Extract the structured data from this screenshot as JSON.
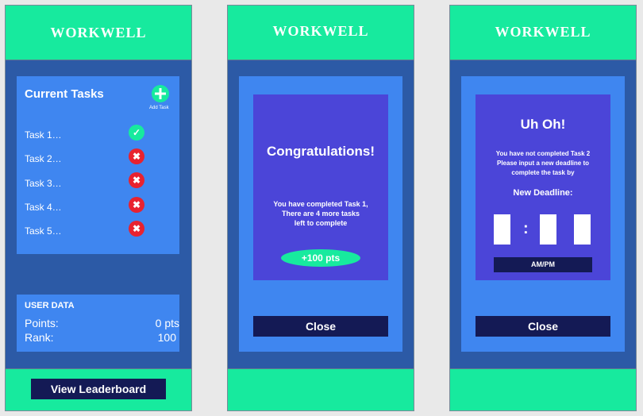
{
  "screens": [
    {
      "brand": "WORKWELL",
      "tasks_title": "Current Tasks",
      "add_task_label": "Add Task",
      "tasks": [
        {
          "label": "Task 1…",
          "status": "complete"
        },
        {
          "label": "Task 2…",
          "status": "incomplete"
        },
        {
          "label": "Task 3…",
          "status": "incomplete"
        },
        {
          "label": "Task 4…",
          "status": "incomplete"
        },
        {
          "label": "Task 5…",
          "status": "incomplete"
        }
      ],
      "user_data_title": "USER DATA",
      "points_label": "Points:",
      "points_value": "0 pts",
      "rank_label": "Rank:",
      "rank_value": "100",
      "leaderboard_button": "View Leaderboard"
    },
    {
      "brand": "WORKWELL",
      "title": "Congratulations!",
      "message_line1": "You have completed Task 1,",
      "message_line2": "There are 4 more tasks",
      "message_line3": "left to complete",
      "points_badge": "+100 pts",
      "close_button": "Close"
    },
    {
      "brand": "WORKWELL",
      "title": "Uh Oh!",
      "message_line1": "You have not completed Task 2",
      "message_line2": "Please input a new deadline to",
      "message_line3": "complete the task by",
      "deadline_label": "New Deadline:",
      "time_separator": ":",
      "ampm_label": "AM/PM",
      "close_button": "Close"
    }
  ],
  "colors": {
    "header_green": "#17ea9e",
    "background_blue": "#2c5aa6",
    "card_blue": "#3f86f0",
    "modal_purple": "#4b45d8",
    "button_navy": "#141a55",
    "error_red": "#e8222f"
  },
  "icons": {
    "complete": "check-circle-icon",
    "incomplete": "x-circle-icon",
    "add": "plus-circle-icon"
  }
}
